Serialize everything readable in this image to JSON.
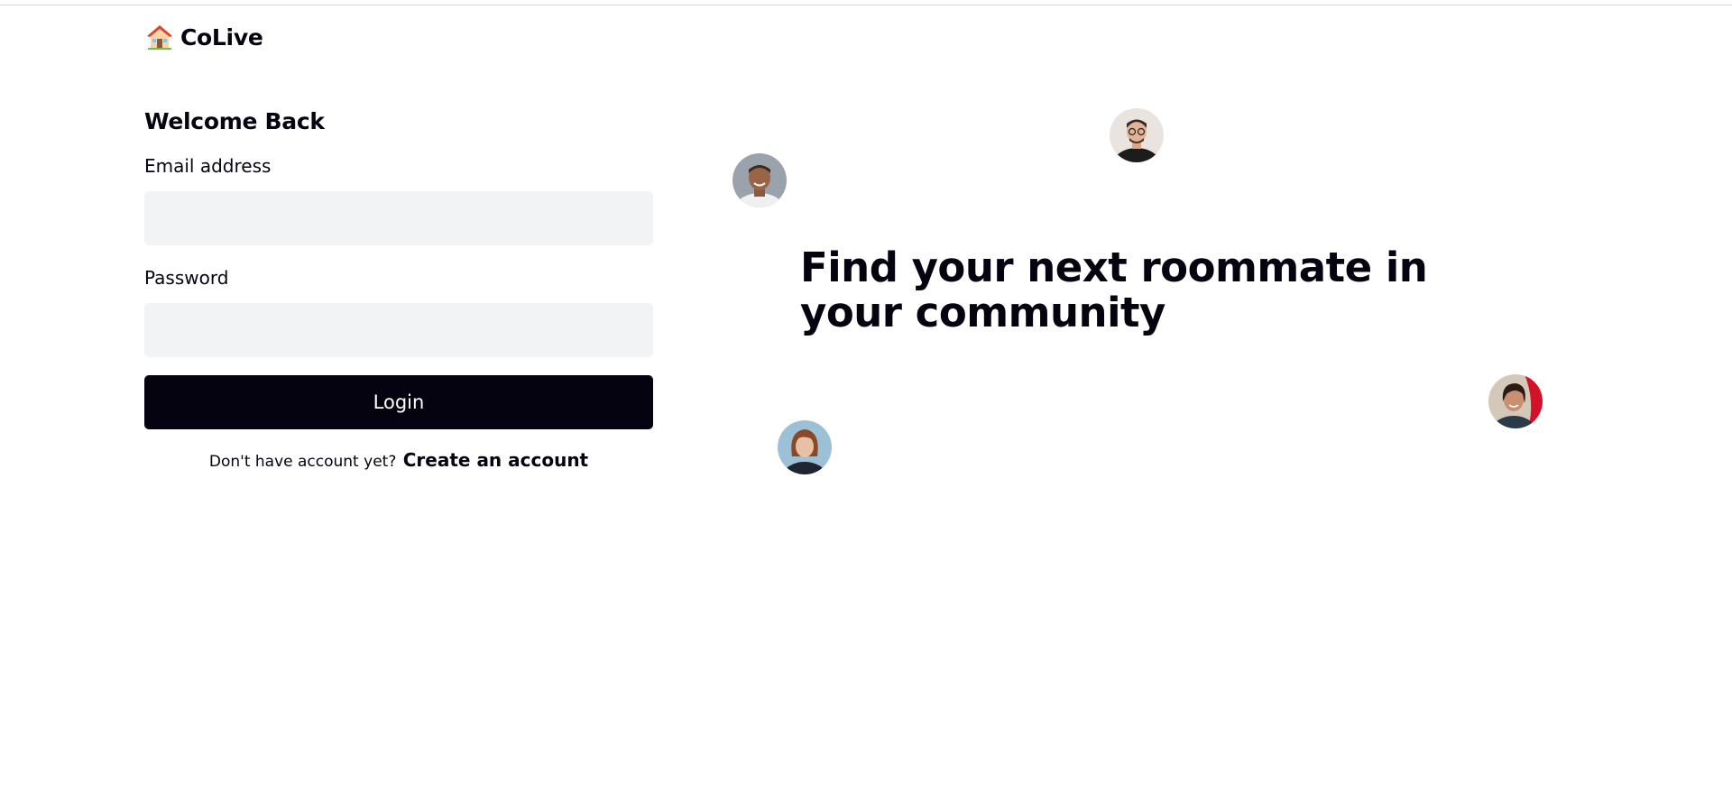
{
  "app": {
    "brand_name": "CoLive",
    "brand_icon": "house-emoji-icon"
  },
  "login_form": {
    "title": "Welcome Back",
    "email_label": "Email address",
    "email_value": "",
    "password_label": "Password",
    "password_value": "",
    "login_button": "Login",
    "signup_prompt": "Don't have account yet?",
    "signup_link": "Create an account"
  },
  "hero": {
    "headline": "Find your next roommate in your community",
    "avatars": [
      "avatar-man-smiling",
      "avatar-man-glasses",
      "avatar-woman-red-scarf",
      "avatar-woman-short-hair"
    ]
  },
  "colors": {
    "primary_dark": "#05030f",
    "input_bg": "#f2f3f5",
    "background": "#ffffff"
  }
}
